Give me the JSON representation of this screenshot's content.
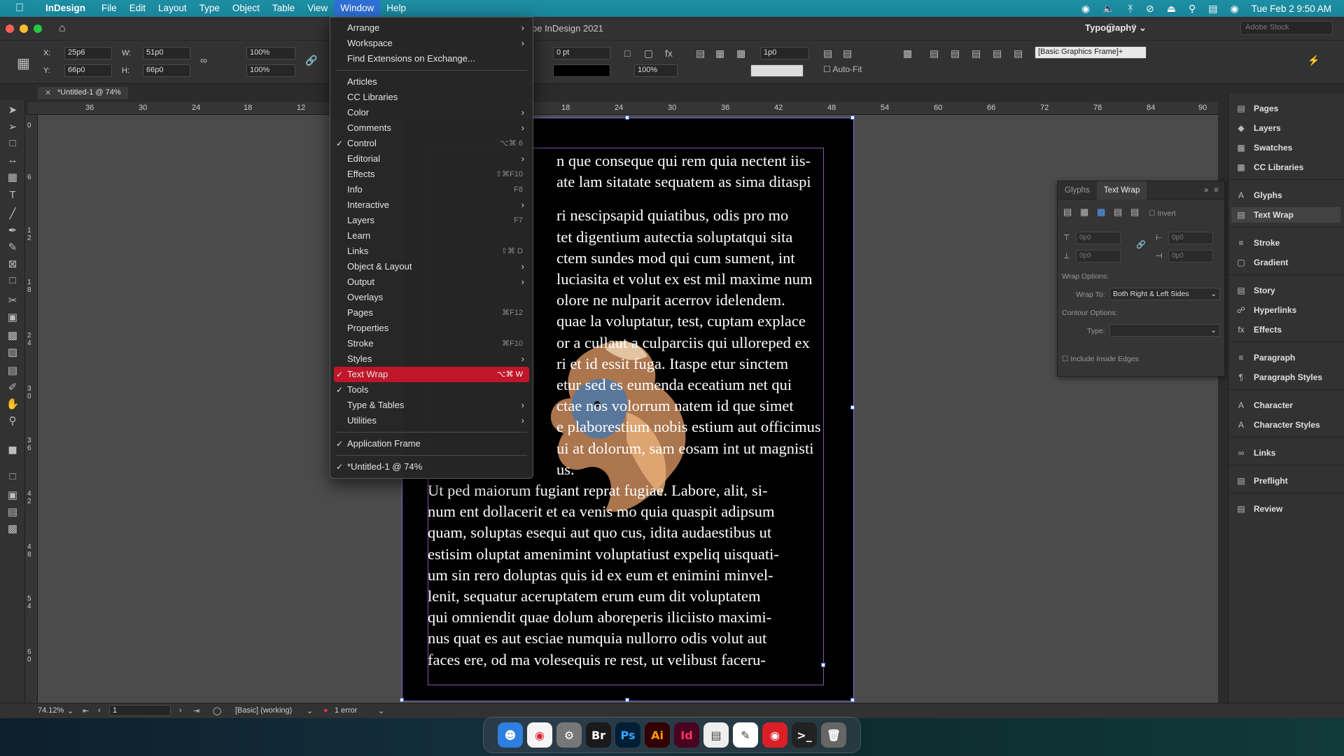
{
  "menubar": {
    "app": "InDesign",
    "items": [
      "File",
      "Edit",
      "Layout",
      "Type",
      "Object",
      "Table",
      "View",
      "Window",
      "Help"
    ],
    "active": "Window",
    "datetime": "Tue Feb 2  9:50 AM"
  },
  "appbar": {
    "title": "be InDesign 2021",
    "workspace": "Typography",
    "search_placeholder": "Adobe Stock"
  },
  "control": {
    "x": "25p6",
    "y": "66p0",
    "w": "51p0",
    "h": "66p0",
    "scale_x": "100%",
    "scale_y": "100%",
    "stroke_weight": "0 pt",
    "opacity": "100%",
    "gap": "1p0",
    "object_style": "[Basic Graphics Frame]+",
    "autofit_label": "Auto-Fit",
    "labels": {
      "x": "X:",
      "y": "Y:",
      "w": "W:",
      "h": "H:"
    }
  },
  "document_tab": "*Untitled-1 @ 74%",
  "hruler": [
    "36",
    "30",
    "24",
    "18",
    "12",
    "18",
    "24",
    "30",
    "36",
    "42",
    "48",
    "54",
    "60",
    "66",
    "72",
    "78",
    "84",
    "90"
  ],
  "vruler": [
    "0",
    "6",
    "1\n2",
    "1\n8",
    "2\n4",
    "3\n0",
    "3\n6",
    "4\n2",
    "4\n8",
    "5\n4",
    "6\n0"
  ],
  "body_lines": [
    "n que conseque qui rem quia nectent iis-",
    "ate lam sitatate sequatem as sima ditaspi",
    "",
    "ri nescipsapid quiatibus, odis pro mo",
    "tet digentium autectia soluptatqui sita",
    "ctem sundes mod qui cum sument, int",
    "luciasita et volut ex est mil maxime num",
    "olore ne nulparit acerrov idelendem.",
    "quae la voluptatur, test, cuptam explace",
    "or a cullaut a culparciis qui ulloreped ex",
    "ri et id essit fuga. Itaspe etur sinctem",
    "etur sed es eumenda eceatium net qui",
    "ctae nos volorrum natem id que simet",
    "e plaborestium nobis estium aut officimus",
    "ui at dolorum, sam eosam int ut magnisti",
    "us.",
    "Ut ped maiorum fugiant reprat fugiae. Labore, alit, si-",
    "num ent dollacerit et ea venis mo quia quaspit adipsum",
    "quam, soluptas esequi aut quo cus, idita audaestibus ut",
    "estisim oluptat amenimint voluptatiust expeliq uisquati-",
    "um sin rero doluptas quis id ex eum et enimini minvel-",
    "lenit, sequatur aceruptatem erum eum dit voluptatem",
    "qui omniendit quae dolum aboreperis iliciisto maximi-",
    "nus quat es aut esciae numquia nullorro odis volut aut",
    "faces ere, od ma volesequis re rest, ut velibust faceru-"
  ],
  "window_menu": {
    "group1": [
      {
        "label": "Arrange",
        "sub": true
      },
      {
        "label": "Workspace",
        "sub": true
      },
      {
        "label": "Find Extensions on Exchange..."
      }
    ],
    "group2": [
      {
        "label": "Articles"
      },
      {
        "label": "CC Libraries"
      },
      {
        "label": "Color",
        "sub": true
      },
      {
        "label": "Comments",
        "sub": true
      },
      {
        "label": "Control",
        "check": true,
        "shortcut": "⌥⌘ 6"
      },
      {
        "label": "Editorial",
        "sub": true
      },
      {
        "label": "Effects",
        "shortcut": "⇧⌘F10"
      },
      {
        "label": "Info",
        "shortcut": "F8"
      },
      {
        "label": "Interactive",
        "sub": true
      },
      {
        "label": "Layers",
        "shortcut": "F7"
      },
      {
        "label": "Learn"
      },
      {
        "label": "Links",
        "shortcut": "⇧⌘ D"
      },
      {
        "label": "Object & Layout",
        "sub": true
      },
      {
        "label": "Output",
        "sub": true
      },
      {
        "label": "Overlays"
      },
      {
        "label": "Pages",
        "shortcut": "⌘F12"
      },
      {
        "label": "Properties"
      },
      {
        "label": "Stroke",
        "shortcut": "⌘F10"
      },
      {
        "label": "Styles",
        "sub": true
      },
      {
        "label": "Text Wrap",
        "check": true,
        "shortcut": "⌥⌘ W",
        "highlight": true
      },
      {
        "label": "Tools",
        "check": true
      },
      {
        "label": "Type & Tables",
        "sub": true
      },
      {
        "label": "Utilities",
        "sub": true
      }
    ],
    "group3": [
      {
        "label": "Application Frame",
        "check": true
      }
    ],
    "group4": [
      {
        "label": "*Untitled-1 @ 74%",
        "check": true
      }
    ]
  },
  "text_wrap_panel": {
    "tabs": [
      "Glyphs",
      "Text Wrap"
    ],
    "active_tab": "Text Wrap",
    "invert_label": "Invert",
    "offsets": [
      "0p0",
      "0p0",
      "0p0",
      "0p0"
    ],
    "wrap_options_label": "Wrap Options:",
    "wrap_to_label": "Wrap To:",
    "wrap_to_value": "Both Right & Left Sides",
    "contour_label": "Contour Options:",
    "type_label": "Type:",
    "type_value": "",
    "include_inside_edges": "Include Inside Edges"
  },
  "right_panels": [
    {
      "label": "Pages",
      "icon": "pages-icon"
    },
    {
      "label": "Layers",
      "icon": "layers-icon"
    },
    {
      "label": "Swatches",
      "icon": "swatches-icon"
    },
    {
      "label": "CC Libraries",
      "icon": "libraries-icon"
    },
    {
      "label": "Glyphs",
      "icon": "glyphs-icon"
    },
    {
      "label": "Text Wrap",
      "icon": "text-wrap-icon",
      "selected": true
    },
    {
      "label": "Stroke",
      "icon": "stroke-icon"
    },
    {
      "label": "Gradient",
      "icon": "gradient-icon"
    },
    {
      "label": "Story",
      "icon": "story-icon"
    },
    {
      "label": "Hyperlinks",
      "icon": "hyperlinks-icon"
    },
    {
      "label": "Effects",
      "icon": "effects-icon"
    },
    {
      "label": "Paragraph",
      "icon": "paragraph-icon"
    },
    {
      "label": "Paragraph Styles",
      "icon": "paragraph-styles-icon"
    },
    {
      "label": "Character",
      "icon": "character-icon"
    },
    {
      "label": "Character Styles",
      "icon": "character-styles-icon"
    },
    {
      "label": "Links",
      "icon": "links-icon"
    },
    {
      "label": "Preflight",
      "icon": "preflight-icon"
    },
    {
      "label": "Review",
      "icon": "review-icon"
    }
  ],
  "status": {
    "zoom": "74.12%",
    "page": "1",
    "profile": "[Basic] (working)",
    "errors": "1 error"
  },
  "dock": {
    "apps": [
      "Finder",
      "Chrome",
      "System Preferences",
      "Bridge",
      "Photoshop",
      "Illustrator",
      "InDesign",
      "Preview",
      "TextEdit",
      "Creative Cloud",
      "Terminal",
      "Trash"
    ],
    "badge": "2",
    "labels": {
      "Bridge": "Br",
      "Photoshop": "Ps",
      "Illustrator": "Ai",
      "InDesign": "Id"
    }
  },
  "colors": {
    "menubar": "#1a8499",
    "highlight": "#c0162a",
    "frame_border": "#7c6fd8",
    "textframe_border": "#8a55a8"
  }
}
